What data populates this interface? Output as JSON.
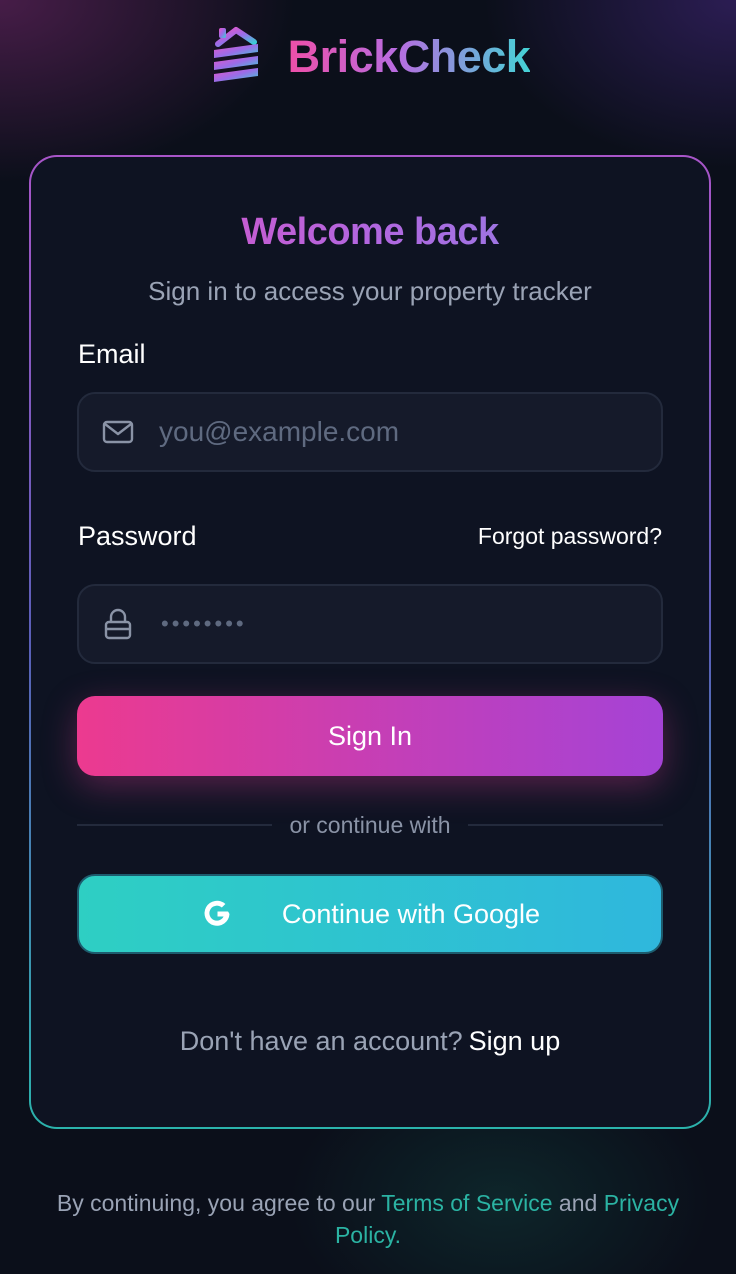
{
  "brand": {
    "name": "BrickCheck",
    "logo_icon": "layered-house-logo-icon"
  },
  "card": {
    "title": "Welcome back",
    "subtitle": "Sign in to access your property tracker"
  },
  "form": {
    "email": {
      "label": "Email",
      "placeholder": "you@example.com",
      "value": "",
      "icon": "mail-icon"
    },
    "password": {
      "label": "Password",
      "masked_value": "••••••••",
      "icon": "lock-icon",
      "forgot_label": "Forgot password?"
    },
    "submit_label": "Sign In",
    "divider_label": "or continue with",
    "google": {
      "label": "Continue with Google",
      "icon": "google-g-icon"
    }
  },
  "signup": {
    "prompt": "Don't have an account?",
    "link_label": "Sign up"
  },
  "footer": {
    "prefix": "By continuing, you agree to our",
    "terms_label": "Terms of Service",
    "and": "and",
    "privacy_label": "Privacy Policy",
    "suffix": "."
  },
  "colors": {
    "background": "#0b0f1a",
    "card": "#0e1322",
    "primary_gradient_start": "#ec3a8f",
    "primary_gradient_end": "#a543d6",
    "google_gradient_start": "#2ecfc3",
    "google_gradient_end": "#2fb7dd",
    "link_teal": "#2bb3a3"
  }
}
